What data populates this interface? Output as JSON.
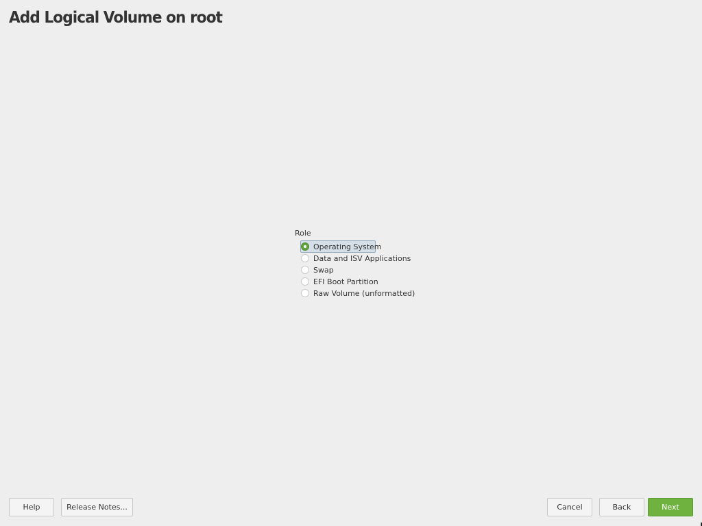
{
  "page": {
    "title": "Add Logical Volume on root"
  },
  "role": {
    "label": "Role",
    "selected_index": 0,
    "options": [
      {
        "label": "Operating System",
        "selected": true
      },
      {
        "label": "Data and ISV Applications",
        "selected": false
      },
      {
        "label": "Swap",
        "selected": false
      },
      {
        "label": "EFI Boot Partition",
        "selected": false
      },
      {
        "label": "Raw Volume (unformatted)",
        "selected": false
      }
    ]
  },
  "buttons": {
    "help": "Help",
    "release_notes": "Release Notes...",
    "cancel": "Cancel",
    "back": "Back",
    "next": "Next"
  },
  "colors": {
    "background": "#eeeeee",
    "accent": "#6fb23f",
    "selection": "#d4dfe8",
    "text": "#333333"
  }
}
